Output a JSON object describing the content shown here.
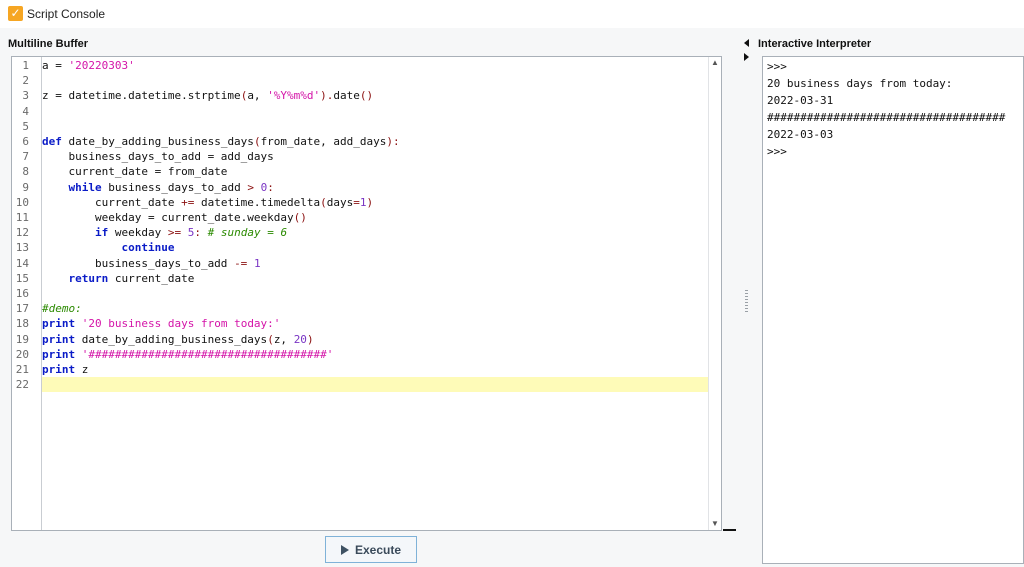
{
  "window": {
    "title": "Script Console",
    "icon": "checkbox-icon",
    "icon_glyph": "✓",
    "icon_color": "#f6a623"
  },
  "multiline_buffer": {
    "title": "Multiline Buffer",
    "current_line": 22,
    "lines": [
      {
        "n": "1",
        "tokens": [
          {
            "t": "a = ",
            "c": "plain"
          },
          {
            "t": "'20220303'",
            "c": "str"
          }
        ]
      },
      {
        "n": "2",
        "tokens": []
      },
      {
        "n": "3",
        "tokens": [
          {
            "t": "z = datetime.datetime.strptime",
            "c": "plain"
          },
          {
            "t": "(",
            "c": "op"
          },
          {
            "t": "a, ",
            "c": "plain"
          },
          {
            "t": "'%Y%m%d'",
            "c": "str"
          },
          {
            "t": ").",
            "c": "op"
          },
          {
            "t": "date",
            "c": "plain"
          },
          {
            "t": "()",
            "c": "op"
          }
        ]
      },
      {
        "n": "4",
        "tokens": []
      },
      {
        "n": "5",
        "tokens": []
      },
      {
        "n": "6",
        "tokens": [
          {
            "t": "def",
            "c": "kw"
          },
          {
            "t": " date_by_adding_business_days",
            "c": "plain"
          },
          {
            "t": "(",
            "c": "op"
          },
          {
            "t": "from_date, add_days",
            "c": "plain"
          },
          {
            "t": "):",
            "c": "op"
          }
        ]
      },
      {
        "n": "7",
        "tokens": [
          {
            "t": "    business_days_to_add = add_days",
            "c": "plain"
          }
        ]
      },
      {
        "n": "8",
        "tokens": [
          {
            "t": "    current_date = from_date",
            "c": "plain"
          }
        ]
      },
      {
        "n": "9",
        "tokens": [
          {
            "t": "    ",
            "c": "plain"
          },
          {
            "t": "while",
            "c": "kw"
          },
          {
            "t": " business_days_to_add ",
            "c": "plain"
          },
          {
            "t": ">",
            "c": "op"
          },
          {
            "t": " ",
            "c": "plain"
          },
          {
            "t": "0",
            "c": "num"
          },
          {
            "t": ":",
            "c": "op"
          }
        ]
      },
      {
        "n": "10",
        "tokens": [
          {
            "t": "        current_date ",
            "c": "plain"
          },
          {
            "t": "+=",
            "c": "op"
          },
          {
            "t": " datetime.timedelta",
            "c": "plain"
          },
          {
            "t": "(",
            "c": "op"
          },
          {
            "t": "days",
            "c": "plain"
          },
          {
            "t": "=",
            "c": "op"
          },
          {
            "t": "1",
            "c": "num"
          },
          {
            "t": ")",
            "c": "op"
          }
        ]
      },
      {
        "n": "11",
        "tokens": [
          {
            "t": "        weekday = current_date.weekday",
            "c": "plain"
          },
          {
            "t": "()",
            "c": "op"
          }
        ]
      },
      {
        "n": "12",
        "tokens": [
          {
            "t": "        ",
            "c": "plain"
          },
          {
            "t": "if",
            "c": "kw"
          },
          {
            "t": " weekday ",
            "c": "plain"
          },
          {
            "t": ">=",
            "c": "op"
          },
          {
            "t": " ",
            "c": "plain"
          },
          {
            "t": "5",
            "c": "num"
          },
          {
            "t": ": ",
            "c": "op"
          },
          {
            "t": "# sunday = 6",
            "c": "cmt"
          }
        ]
      },
      {
        "n": "13",
        "tokens": [
          {
            "t": "            ",
            "c": "plain"
          },
          {
            "t": "continue",
            "c": "kw"
          }
        ]
      },
      {
        "n": "14",
        "tokens": [
          {
            "t": "        business_days_to_add ",
            "c": "plain"
          },
          {
            "t": "-=",
            "c": "op"
          },
          {
            "t": " ",
            "c": "plain"
          },
          {
            "t": "1",
            "c": "num"
          }
        ]
      },
      {
        "n": "15",
        "tokens": [
          {
            "t": "    ",
            "c": "plain"
          },
          {
            "t": "return",
            "c": "kw"
          },
          {
            "t": " current_date",
            "c": "plain"
          }
        ]
      },
      {
        "n": "16",
        "tokens": []
      },
      {
        "n": "17",
        "tokens": [
          {
            "t": "#demo:",
            "c": "cmt"
          }
        ]
      },
      {
        "n": "18",
        "tokens": [
          {
            "t": "print",
            "c": "kw"
          },
          {
            "t": " ",
            "c": "plain"
          },
          {
            "t": "'20 business days from today:'",
            "c": "str"
          }
        ]
      },
      {
        "n": "19",
        "tokens": [
          {
            "t": "print",
            "c": "kw"
          },
          {
            "t": " date_by_adding_business_days",
            "c": "plain"
          },
          {
            "t": "(",
            "c": "op"
          },
          {
            "t": "z, ",
            "c": "plain"
          },
          {
            "t": "20",
            "c": "num"
          },
          {
            "t": ")",
            "c": "op"
          }
        ]
      },
      {
        "n": "20",
        "tokens": [
          {
            "t": "print",
            "c": "kw"
          },
          {
            "t": " ",
            "c": "plain"
          },
          {
            "t": "'####################################'",
            "c": "str"
          }
        ]
      },
      {
        "n": "21",
        "tokens": [
          {
            "t": "print",
            "c": "kw"
          },
          {
            "t": " z",
            "c": "plain"
          }
        ]
      },
      {
        "n": "22",
        "tokens": []
      }
    ]
  },
  "execute_button": {
    "label": "Execute",
    "icon": "play-icon"
  },
  "splitter": {
    "collapse_icon": "arrow-left-icon",
    "expand_icon": "arrow-right-icon",
    "grip_icon": "grip-icon"
  },
  "interactive_interpreter": {
    "title": "Interactive Interpreter",
    "output": [
      ">>>",
      "20 business days from today:",
      "2022-03-31",
      "####################################",
      "2022-03-03",
      ">>>"
    ]
  },
  "colors": {
    "keyword": "#0a1bc7",
    "string": "#d414a8",
    "number": "#7a35c4",
    "operator": "#8b1010",
    "comment": "#2b8a00",
    "current_line_highlight": "#fefbb8",
    "button_border": "#7fb2d8"
  }
}
